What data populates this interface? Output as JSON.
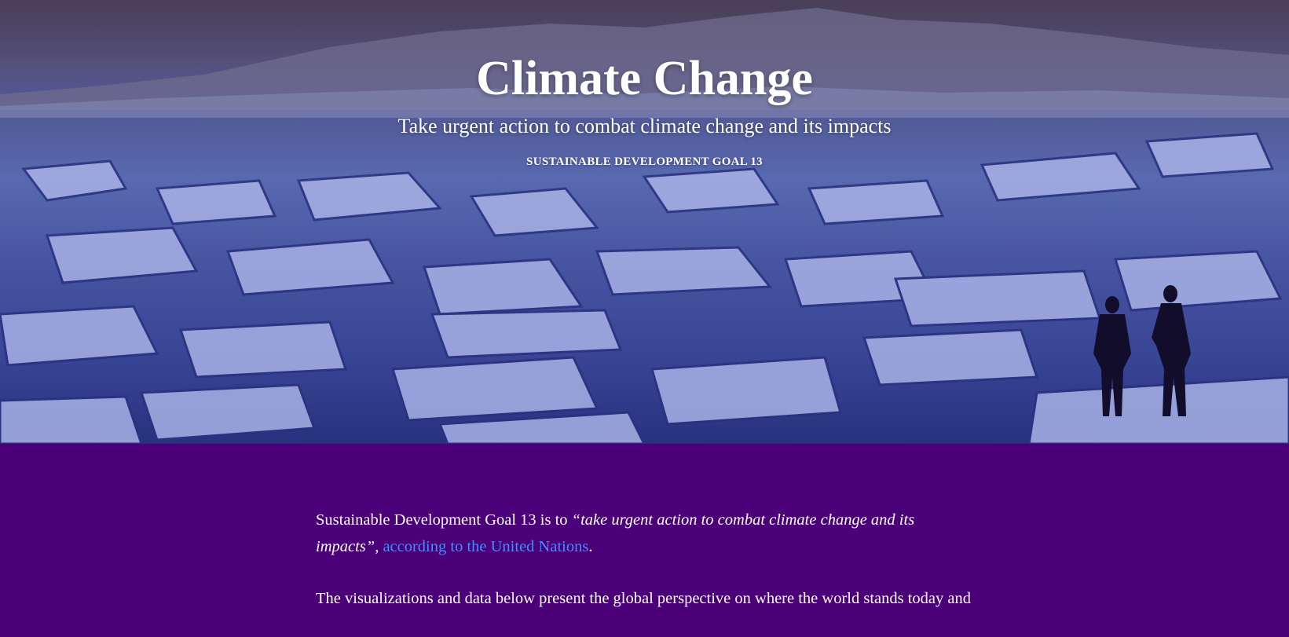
{
  "hero": {
    "title": "Climate Change",
    "subtitle": "Take urgent action to combat climate change and its impacts",
    "kicker": "SUSTAINABLE DEVELOPMENT GOAL 13",
    "background_image": "photo of cracked sea ice with two people standing on the right"
  },
  "intro": {
    "p1_prefix": "Sustainable Development Goal 13 is to ",
    "p1_quote": "“take urgent action to combat climate change and its impacts”",
    "p1_comma": ", ",
    "p1_link": "according to the United Nations",
    "p1_suffix": ".",
    "p2": "The visualizations and data below present the global perspective on where the world stands today and"
  },
  "colors": {
    "page_background": "#4b007a",
    "link": "#3f8fff",
    "text": "#ffffff"
  }
}
